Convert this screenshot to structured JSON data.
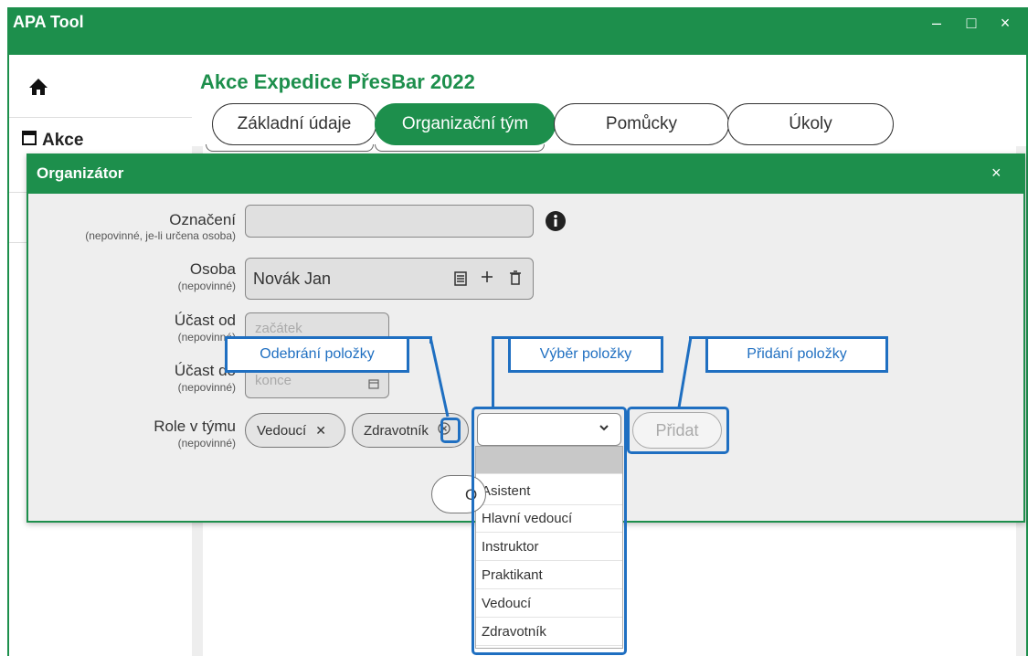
{
  "window": {
    "title": "APA Tool",
    "controls": {
      "minimize": "–",
      "maximize": "□",
      "close": "×"
    }
  },
  "sidebar": {
    "home_icon": "home-icon",
    "items": [
      {
        "icon": "calendar-icon",
        "label": "Akce"
      }
    ]
  },
  "page": {
    "title": "Akce Expedice PřesBar 2022",
    "tabs": [
      "Základní údaje",
      "Organizační tým",
      "Pomůcky",
      "Úkoly"
    ],
    "active_tab": "Organizační tým"
  },
  "dialog": {
    "title": "Organizátor",
    "close": "×",
    "fields": {
      "oznaceni": {
        "label": "Označení",
        "sublabel": "(nepovinné, je-li určena osoba)",
        "value": ""
      },
      "osoba": {
        "label": "Osoba",
        "sublabel": "(nepovinné)",
        "value": "Novák Jan"
      },
      "ucast_od": {
        "label": "Účast od",
        "sublabel": "(nepovinné)",
        "placeholder": "začátek"
      },
      "ucast_do": {
        "label": "Účast do",
        "sublabel": "(nepovinné)",
        "placeholder": "konce"
      },
      "role": {
        "label": "Role v týmu",
        "sublabel": "(nepovinné)",
        "chips": [
          "Vedoucí",
          "Zdravotník"
        ],
        "add_button": "Přidat"
      }
    },
    "ok_fragment": "O",
    "dropdown_options": [
      "",
      "Asistent",
      "Hlavní vedoucí",
      "Instruktor",
      "Praktikant",
      "Vedoucí",
      "Zdravotník"
    ]
  },
  "callouts": {
    "remove": "Odebrání položky",
    "select": "Výběr položky",
    "add": "Přidání položky"
  },
  "colors": {
    "brand_green": "#1d8f4c",
    "callout_blue": "#1f6fc1"
  }
}
